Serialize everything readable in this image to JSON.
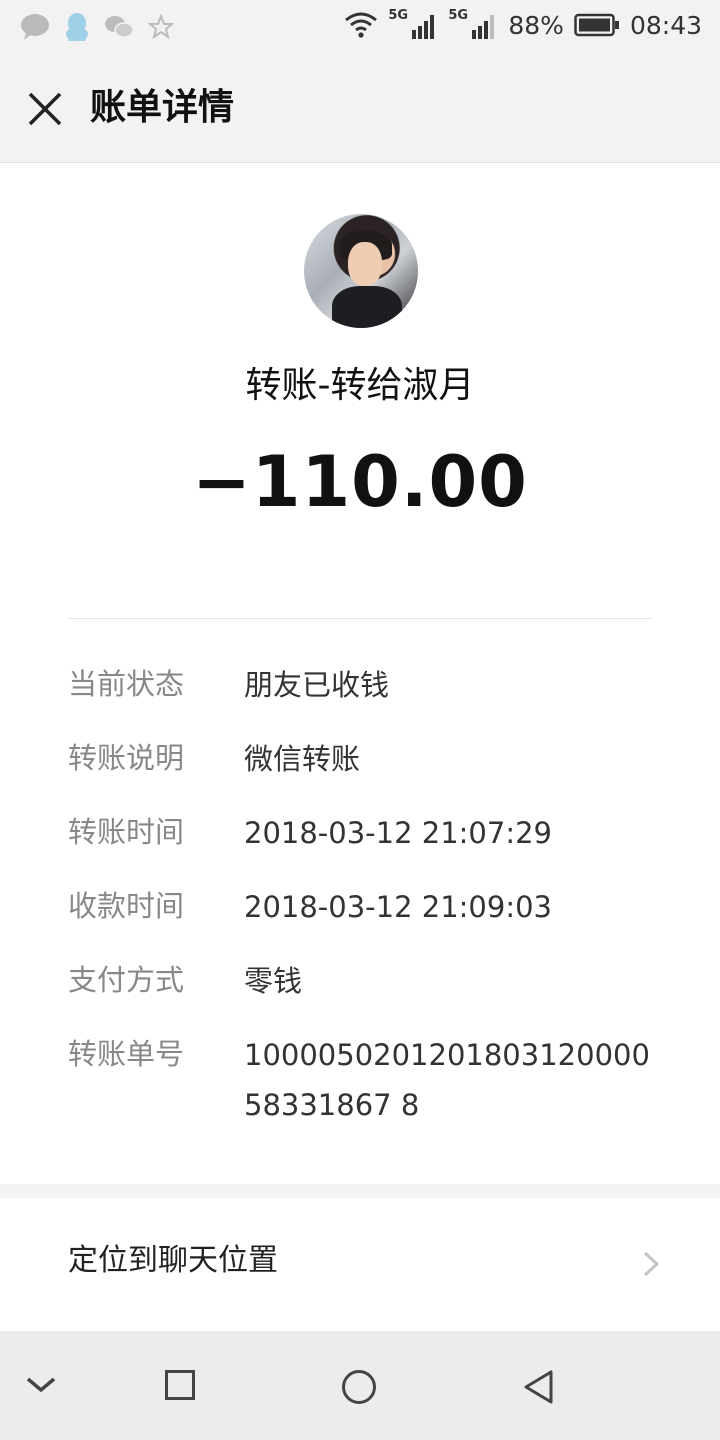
{
  "status_bar": {
    "network_label_1": "5G",
    "network_label_2": "5G",
    "battery_percent": "88%",
    "time": "08:43",
    "left_icons": [
      "message-icon",
      "qq-icon",
      "wechat-icon",
      "star-icon"
    ]
  },
  "header": {
    "title": "账单详情"
  },
  "transaction": {
    "title": "转账-转给淑月",
    "amount": "−110.00"
  },
  "details": [
    {
      "label": "当前状态",
      "value": "朋友已收钱"
    },
    {
      "label": "转账说明",
      "value": "微信转账"
    },
    {
      "label": "转账时间",
      "value": "2018-03-12 21:07:29"
    },
    {
      "label": "收款时间",
      "value": "2018-03-12 21:09:03"
    },
    {
      "label": "支付方式",
      "value": "零钱"
    },
    {
      "label": "转账单号",
      "value": "100005020120180312000058331867 8"
    }
  ],
  "locate": {
    "label": "定位到聊天位置"
  },
  "nav_bar": {
    "icons": [
      "chevron-down-icon",
      "recent-apps-icon",
      "home-icon",
      "back-icon"
    ]
  }
}
